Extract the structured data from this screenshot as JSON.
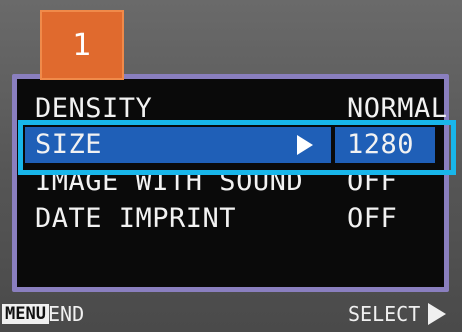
{
  "tab": {
    "label": "1"
  },
  "menu": {
    "items": [
      {
        "label": "DENSITY",
        "value": "NORMAL",
        "selected": false
      },
      {
        "label": "SIZE",
        "value": "1280",
        "selected": true
      },
      {
        "label": "IMAGE WITH SOUND",
        "value": "OFF",
        "selected": false
      },
      {
        "label": "DATE IMPRINT",
        "value": "OFF",
        "selected": false
      }
    ]
  },
  "footer": {
    "menu_key": "MENU",
    "end_label": "END",
    "select_label": "SELECT"
  },
  "colors": {
    "tab": "#e06a2e",
    "panel_border": "#8a7fbf",
    "selection": "#1f5fb7",
    "callout": "#18b6ea"
  }
}
